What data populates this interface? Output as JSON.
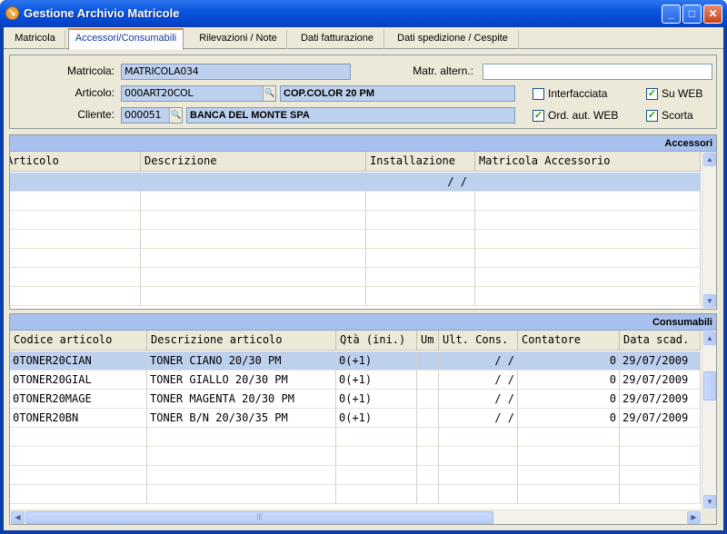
{
  "window": {
    "title": "Gestione Archivio Matricole",
    "app_icon": "app-icon",
    "minimize": "_",
    "maximize": "□",
    "close": "✕"
  },
  "tabs": [
    {
      "label": "Matricola"
    },
    {
      "label": "Accessori/Consumabili",
      "active": true
    },
    {
      "label": "Rilevazioni / Note"
    },
    {
      "label": "Dati fatturazione"
    },
    {
      "label": "Dati spedizione / Cespite"
    }
  ],
  "form": {
    "matricola_label": "Matricola:",
    "matricola_value": "MATRICOLA034",
    "matr_altern_label": "Matr. altern.:",
    "matr_altern_value": "",
    "articolo_label": "Articolo:",
    "articolo_code": "000ART20COL",
    "articolo_desc": "COP.COLOR 20 PM",
    "cliente_label": "Cliente:",
    "cliente_code": "000051",
    "cliente_name": "BANCA DEL MONTE SPA",
    "checkboxes": [
      {
        "label": "Interfacciata",
        "checked": false
      },
      {
        "label": "Su WEB",
        "checked": true
      },
      {
        "label": "Ord. aut. WEB",
        "checked": true
      },
      {
        "label": "Scorta",
        "checked": true
      }
    ]
  },
  "accessori": {
    "caption": "Accessori",
    "columns": [
      "Articolo",
      "Descrizione",
      "Installazione",
      "Matricola Accessorio"
    ],
    "first_row_date": "/ /"
  },
  "consumabili": {
    "caption": "Consumabili",
    "columns": [
      "Codice articolo",
      "Descrizione articolo",
      "Qtà (ini.)",
      "Um",
      "Ult. Cons.",
      "Contatore",
      "Data scad."
    ],
    "rows": [
      [
        "0TONER20CIAN",
        "TONER CIANO 20/30 PM",
        "0(+1)",
        "",
        "/ /",
        "0",
        "29/07/2009"
      ],
      [
        "0TONER20GIAL",
        "TONER GIALLO 20/30 PM",
        "0(+1)",
        "",
        "/ /",
        "0",
        "29/07/2009"
      ],
      [
        "0TONER20MAGE",
        "TONER MAGENTA 20/30 PM",
        "0(+1)",
        "",
        "/ /",
        "0",
        "29/07/2009"
      ],
      [
        "0TONER20BN",
        "TONER B/N 20/30/35 PM",
        "0(+1)",
        "",
        "/ /",
        "0",
        "29/07/2009"
      ]
    ]
  },
  "icons": {
    "lookup": "magnifier-icon",
    "check": "✓",
    "scroll_up": "▲",
    "scroll_down": "▼",
    "scroll_left": "◀",
    "scroll_right": "▶"
  }
}
